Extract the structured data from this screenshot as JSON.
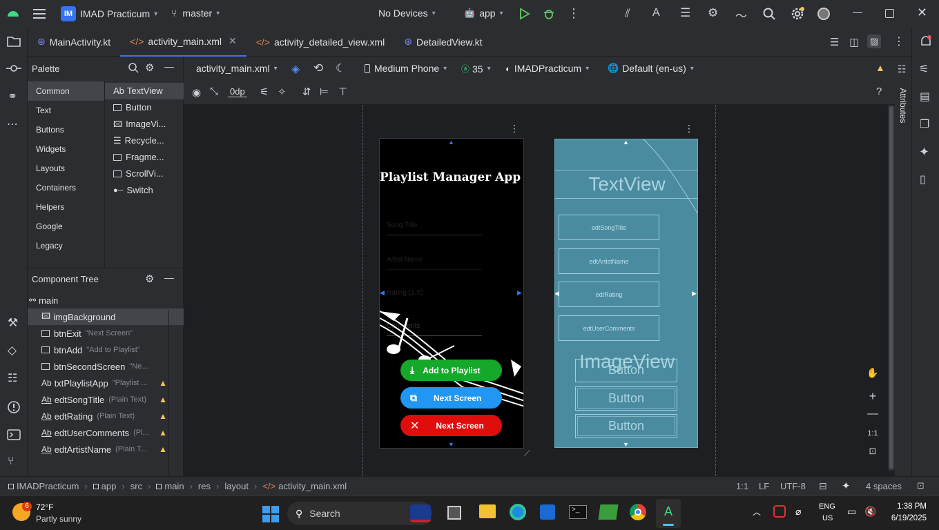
{
  "titlebar": {
    "project": "IMAD Practicum",
    "project_badge": "IM",
    "branch": "master",
    "devices": "No Devices",
    "run_config": "app"
  },
  "tabs": [
    {
      "label": "MainActivity.kt"
    },
    {
      "label": "activity_main.xml"
    },
    {
      "label": "activity_detailed_view.xml"
    },
    {
      "label": "DetailedView.kt"
    }
  ],
  "palette": {
    "title": "Palette",
    "categories": [
      "Common",
      "Text",
      "Buttons",
      "Widgets",
      "Layouts",
      "Containers",
      "Helpers",
      "Google",
      "Legacy"
    ],
    "items": [
      {
        "prefix": "Ab",
        "label": "TextView"
      },
      {
        "label": "Button"
      },
      {
        "label": "ImageVi..."
      },
      {
        "label": "Recycle..."
      },
      {
        "label": "Fragme..."
      },
      {
        "label": "ScrollVi..."
      },
      {
        "label": "Switch"
      }
    ]
  },
  "component_tree": {
    "title": "Component Tree",
    "root": "main",
    "rows": [
      {
        "name": "imgBackground",
        "hint": ""
      },
      {
        "name": "btnExit",
        "hint": "\"Next Screen\""
      },
      {
        "name": "btnAdd",
        "hint": "\"Add to Playlist\""
      },
      {
        "name": "btnSecondScreen",
        "hint": "\"Ne..."
      },
      {
        "prefix": "Ab",
        "name": "txtPlaylistApp",
        "hint": "\"Playlist ..."
      },
      {
        "prefix": "Ab",
        "name": "edtSongTitle",
        "hint": "(Plain Text)"
      },
      {
        "prefix": "Ab",
        "name": "edtRating",
        "hint": "(Plain Text)"
      },
      {
        "prefix": "Ab",
        "name": "edtUserComments",
        "hint": "(Pl..."
      },
      {
        "prefix": "Ab",
        "name": "edtArtistName",
        "hint": "(Plain T..."
      }
    ]
  },
  "editor_toolbar": {
    "file": "activity_main.xml",
    "device": "Medium Phone",
    "api": "35",
    "theme": "IMADPracticum",
    "locale": "Default (en-us)",
    "margin": "0dp"
  },
  "attributes_label": "Attributes",
  "design": {
    "title": "Playlist Manager App",
    "hints": [
      "Song Title",
      "Artist Name",
      "Rating (1-5)",
      "Comments"
    ],
    "btn_add": "Add to Playlist",
    "btn_next": "Next Screen",
    "btn_exit": "Next Screen"
  },
  "blueprint": {
    "textview": "TextView",
    "fields": [
      "edtSongTitle",
      "edtArtistName",
      "edtRating",
      "edtUserComments"
    ],
    "imageview": "ImageView",
    "buttons": [
      "Button",
      "Button",
      "Button"
    ]
  },
  "zoom": {
    "fit": "1:1"
  },
  "statusbar": {
    "crumbs": [
      "IMADPracticum",
      "app",
      "src",
      "main",
      "res",
      "layout",
      "activity_main.xml"
    ],
    "position": "1:1",
    "line_sep": "LF",
    "encoding": "UTF-8",
    "indent": "4 spaces"
  },
  "taskbar": {
    "weather_temp": "72°F",
    "weather_desc": "Partly sunny",
    "weather_badge": "6",
    "search": "Search",
    "lang1": "ENG",
    "lang2": "US",
    "time": "1:38 PM",
    "date": "6/19/2025"
  },
  "colors": {
    "accent": "#3574f0",
    "add_btn": "#16a82a",
    "next_btn": "#2196f3",
    "exit_btn": "#e00d0d",
    "blueprint": "#4a8ba0"
  }
}
